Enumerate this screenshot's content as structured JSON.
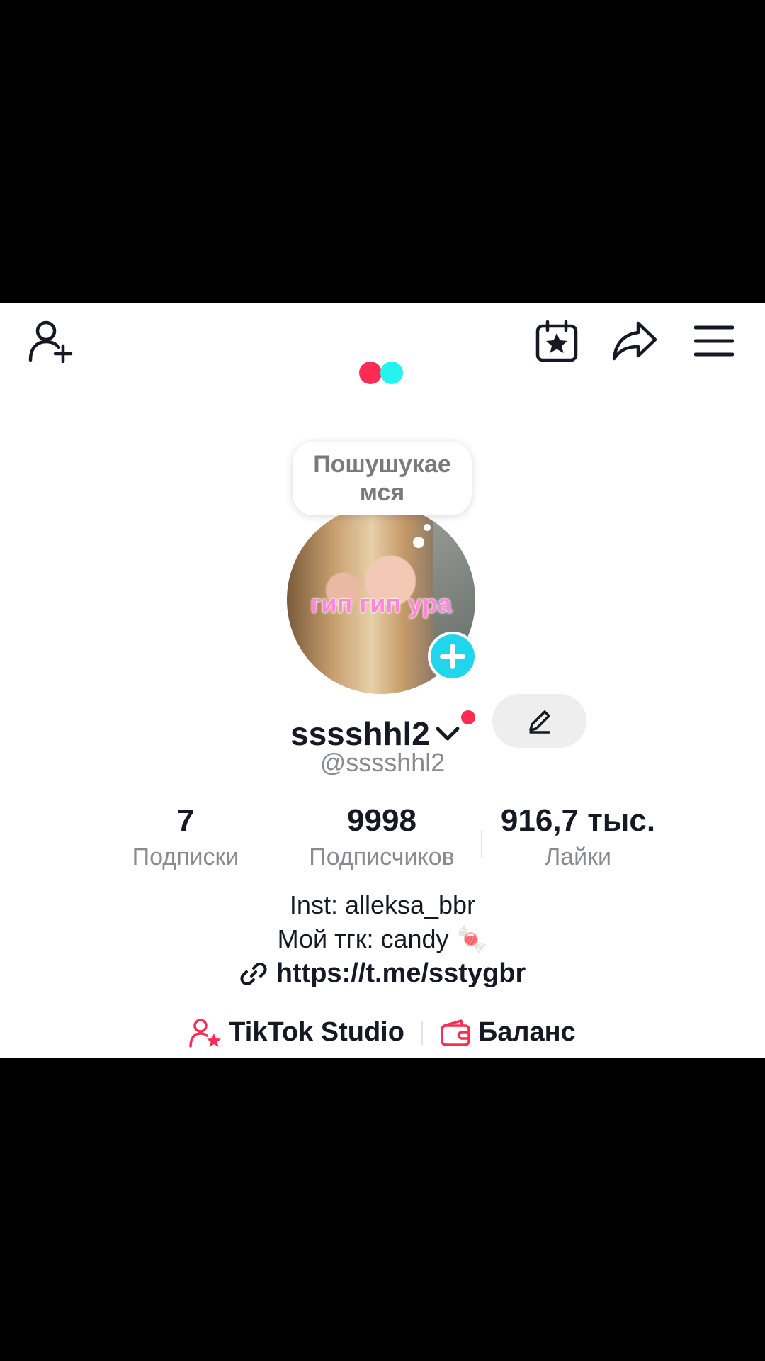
{
  "header": {
    "icons": {
      "add_friend": "add-user-icon",
      "calendar": "calendar-star-icon",
      "share": "share-icon",
      "menu": "hamburger-menu-icon"
    }
  },
  "brand": {
    "dot_colors": [
      "#fe2c55",
      "#25f4ee"
    ]
  },
  "profile": {
    "bubble_text": "Пошушукае мся",
    "avatar_caption": "гип гип ура",
    "display_name": "sssshhl2",
    "handle": "@sssshhl2"
  },
  "stats": [
    {
      "value": "7",
      "label": "Подписки"
    },
    {
      "value": "9998",
      "label": "Подписчиков"
    },
    {
      "value": "916,7 тыс.",
      "label": "Лайки"
    }
  ],
  "bio": {
    "line1": "Inst: alleksa_bbr",
    "line2": "Мой тгк: candy 🍬",
    "link": "https://t.me/sstygbr"
  },
  "tools": {
    "studio_label": "TikTok Studio",
    "balance_label": "Баланс"
  },
  "colors": {
    "accent": "#fe2c55",
    "cyan": "#25f4ee",
    "badge": "#20d5ec"
  }
}
